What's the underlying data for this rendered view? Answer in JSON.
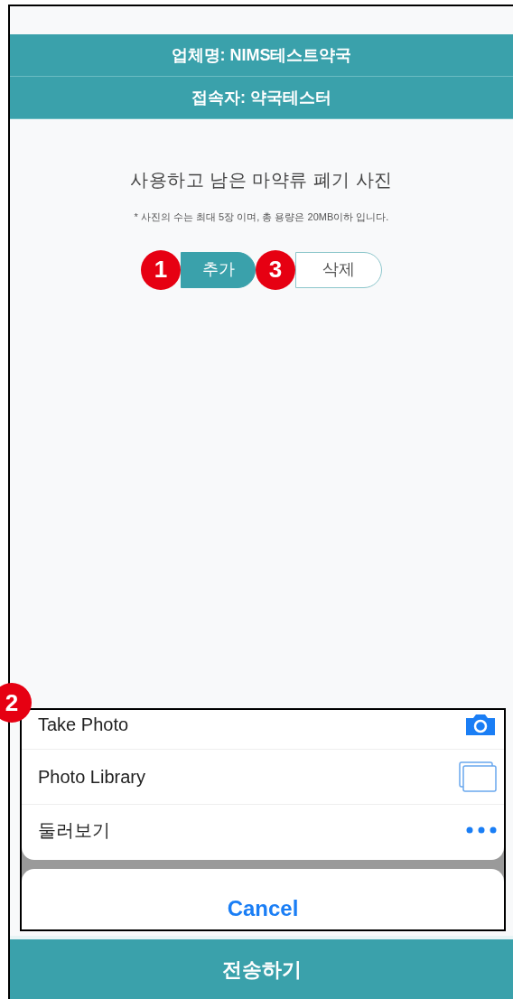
{
  "header": {
    "lines": [
      "업체명: NIMS테스트약국",
      "접속자: 약국테스터"
    ]
  },
  "title": "사용하고 남은 마약류 폐기 사진",
  "note": "* 사진의 수는 최대 5장 이며, 총 용량은 20MB이하 입니다.",
  "segments": [
    {
      "label": "추가",
      "selected": true,
      "badge": "1"
    },
    {
      "label": "삭제",
      "selected": false,
      "badge": "3"
    }
  ],
  "action_sheet": {
    "badge": "2",
    "options": [
      {
        "label": "Take Photo",
        "kind": "camera"
      },
      {
        "label": "Photo Library",
        "kind": "library"
      },
      {
        "label": "둘러보기",
        "kind": "more"
      }
    ],
    "cancel": "Cancel"
  },
  "submit_button": "전송하기"
}
